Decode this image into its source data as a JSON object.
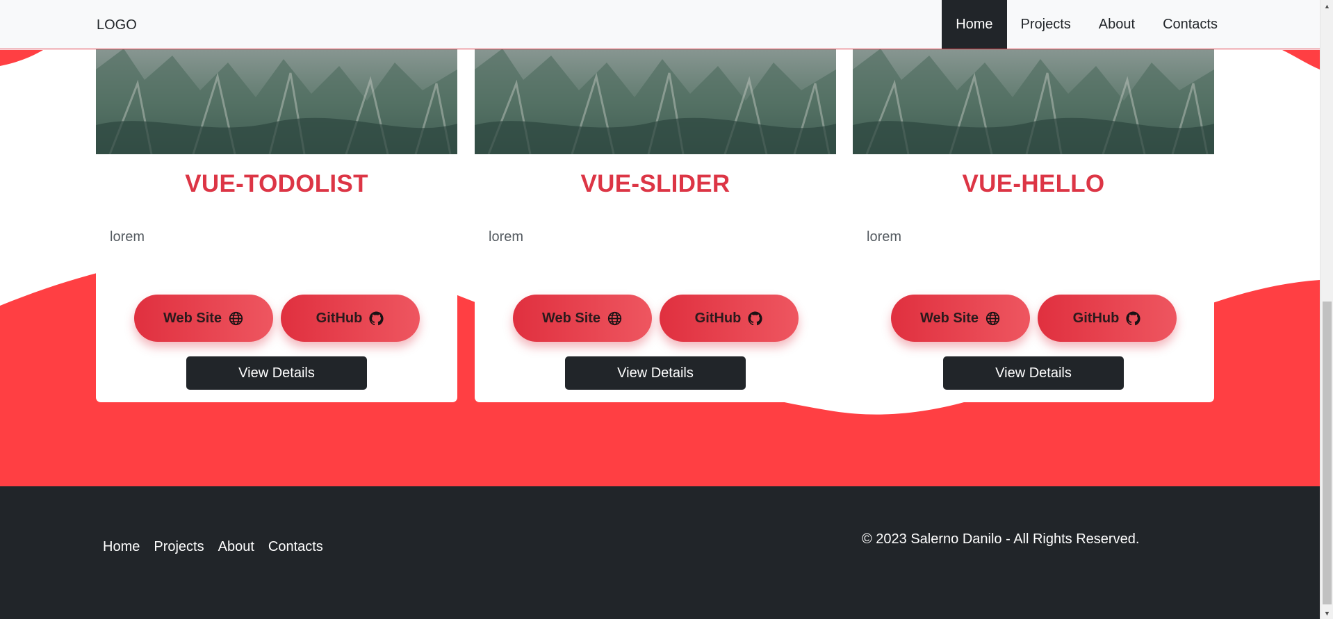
{
  "navbar": {
    "logo": "LOGO",
    "links": [
      "Home",
      "Projects",
      "About",
      "Contacts"
    ],
    "active": "Home"
  },
  "projects": [
    {
      "title": "VUE-TODOLIST",
      "description": "lorem",
      "website_label": "Web Site",
      "github_label": "GitHub",
      "details_label": "View Details"
    },
    {
      "title": "VUE-SLIDER",
      "description": "lorem",
      "website_label": "Web Site",
      "github_label": "GitHub",
      "details_label": "View Details"
    },
    {
      "title": "VUE-HELLO",
      "description": "lorem",
      "website_label": "Web Site",
      "github_label": "GitHub",
      "details_label": "View Details"
    }
  ],
  "footer": {
    "links": [
      "Home",
      "Projects",
      "About",
      "Contacts"
    ],
    "copyright": "© 2023 Salerno Danilo - All Rights Reserved."
  },
  "icons": {
    "website": "globe-icon",
    "github": "github-icon"
  },
  "colors": {
    "accent": "#dc3545",
    "wave": "#ff3f43",
    "dark": "#212529",
    "navbar_bg": "#f8f9fa"
  }
}
